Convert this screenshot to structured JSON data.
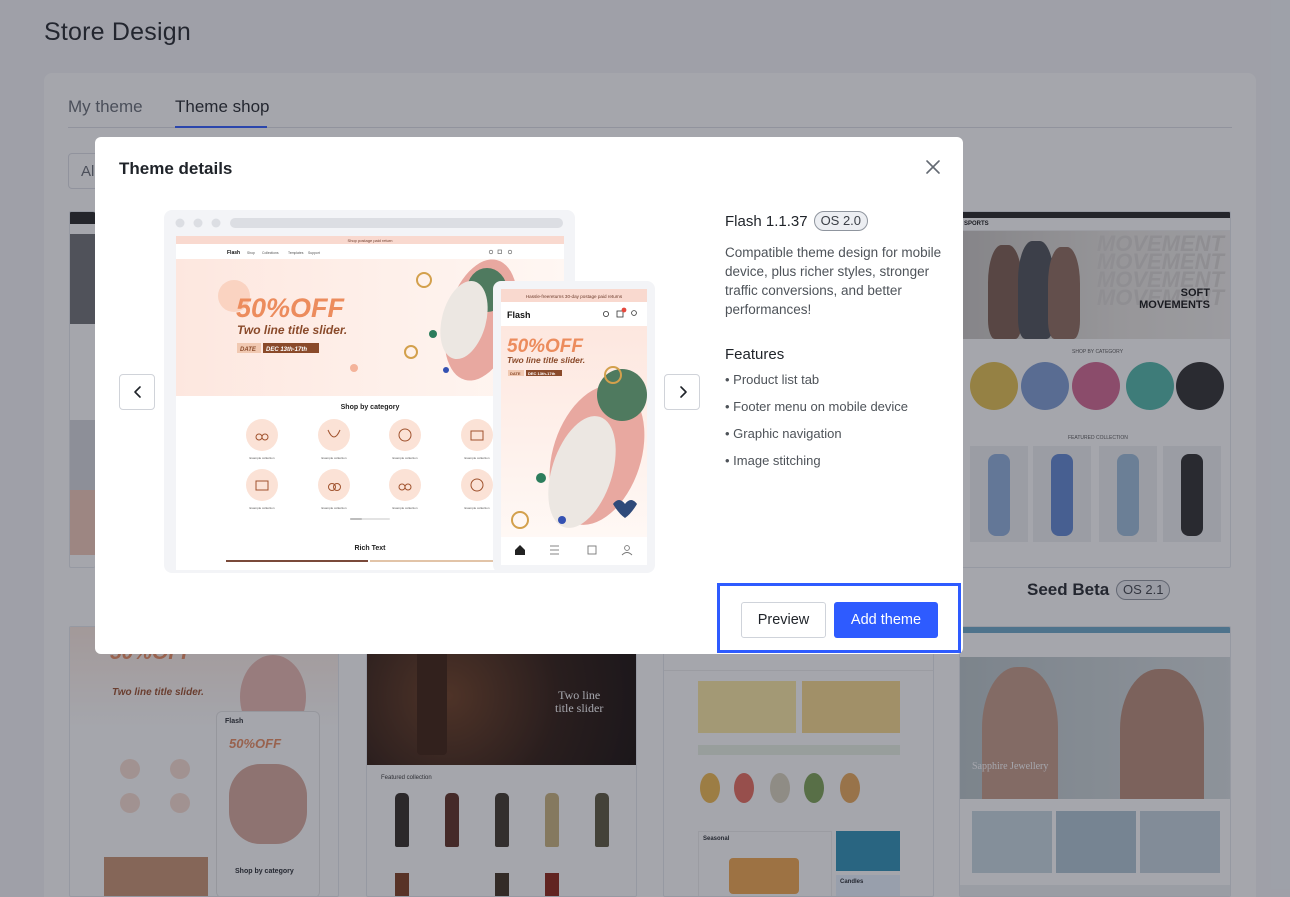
{
  "page": {
    "title": "Store Design"
  },
  "tabs": [
    {
      "label": "My theme"
    },
    {
      "label": "Theme shop"
    }
  ],
  "filter": {
    "value": "Al"
  },
  "card_fitness": {
    "name": "Seed Beta",
    "os": "OS 2.1",
    "hero_big_text": "MOVEMENT",
    "hero_line1": "SOFT",
    "hero_line2": "MOVEMENTS",
    "section_category": "SHOP BY CATEGORY",
    "section_featured": "FEATURED COLLECTION"
  },
  "card_flash2": {
    "promo": "50%OFF",
    "subtitle": "Two line title slider.",
    "logo": "Flash",
    "shop_by_category": "Shop by category"
  },
  "card_wine": {
    "hero_line1": "Two line",
    "hero_line2": "title slider",
    "section": "Featured collection"
  },
  "card_grocery": {
    "section1": "Seasonal",
    "section2": "Candles"
  },
  "card_jewel": {
    "hero_text": "Sapphire Jewellery"
  },
  "modal": {
    "title": "Theme details",
    "theme_name": "Flash 1.1.37",
    "os_badge": "OS 2.0",
    "description": "Compatible theme design for mobile device, plus richer styles, stronger traffic conversions, and better performances!",
    "features_title": "Features",
    "features": [
      "• Product list tab",
      "• Footer menu on mobile device",
      "• Graphic navigation",
      "• Image stitching"
    ],
    "preview_button": "Preview",
    "add_button": "Add theme",
    "accent_color": "#2e5bff"
  },
  "preview": {
    "desktop": {
      "announcement": "Shop postage paid return",
      "logo": "Flash",
      "nav": [
        "Shop",
        "Collections",
        "Templates",
        "Support"
      ],
      "promo": "50%OFF",
      "subtitle": "Two line title slider.",
      "date_label": "DATE",
      "date_value": "DEC 13th-17th",
      "shop_by_category": "Shop by category",
      "category_caption": "Example collection",
      "rich_text": "Rich Text"
    },
    "mobile": {
      "announcement": "Hassle-freereturns 30-day postage paid returns",
      "logo": "Flash",
      "promo": "50%OFF",
      "subtitle": "Two line title slider.",
      "date_label": "DATE",
      "date_value": "DEC 13th-17th"
    }
  }
}
